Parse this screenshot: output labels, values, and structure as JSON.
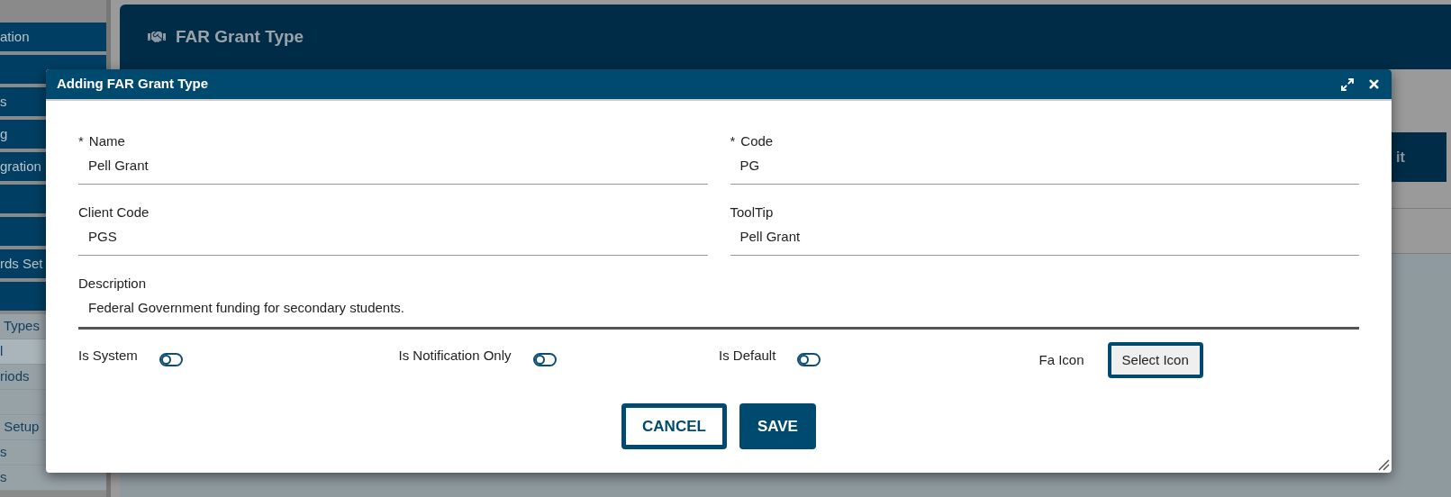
{
  "background": {
    "sidebar_items": [
      {
        "kind": "dark",
        "label": "ation"
      },
      {
        "kind": "dark"
      },
      {
        "kind": "dark",
        "label": "s"
      },
      {
        "kind": "dark",
        "label": "g"
      },
      {
        "kind": "dark",
        "label": "gration"
      },
      {
        "kind": "dark"
      },
      {
        "kind": "dark"
      },
      {
        "kind": "dark",
        "label": "rds Set"
      },
      {
        "kind": "dark"
      },
      {
        "kind": "light",
        "label": "Types",
        "selected": false
      },
      {
        "kind": "light",
        "label": "l",
        "selected": true
      },
      {
        "kind": "light",
        "label": "riods",
        "selected": false
      },
      {
        "kind": "light",
        "selected": false
      },
      {
        "kind": "light",
        "label": "Setup",
        "selected": false
      },
      {
        "kind": "light",
        "label": "s",
        "selected": false
      },
      {
        "kind": "light",
        "label": "s",
        "selected": false
      }
    ],
    "page_title": "FAR Grant Type",
    "tab": "it"
  },
  "dialog": {
    "title": "Adding FAR Grant Type",
    "fields": [
      {
        "label": "Name",
        "marker": "*",
        "value": "Pell Grant"
      },
      {
        "label": "Code",
        "marker": "*",
        "value": "PG"
      },
      {
        "label": "Client Code",
        "value": "PGS"
      },
      {
        "label": "ToolTip",
        "value": "Pell Grant"
      }
    ],
    "description": {
      "label": "Description",
      "value": "Federal Government funding for secondary students."
    },
    "toggles": [
      {
        "label": "Is System",
        "on": false
      },
      {
        "label": "Is Notification Only",
        "on": false
      },
      {
        "label": "Is Default",
        "on": false
      }
    ],
    "icon_field": {
      "label": "Fa Icon",
      "button": "Select Icon"
    },
    "buttons": [
      {
        "label": "CANCEL",
        "kind": "outline"
      },
      {
        "label": "SAVE",
        "kind": "primary"
      }
    ]
  }
}
